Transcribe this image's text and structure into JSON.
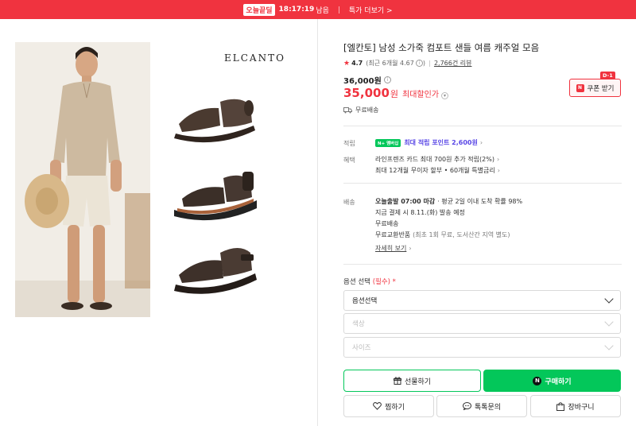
{
  "banner": {
    "logo": "오늘끝딜",
    "time": "18:17:19",
    "time_suffix": "남음",
    "link": "특가 더보기 >"
  },
  "gallery": {
    "brand": "ELCANTO"
  },
  "product": {
    "title": "[엘칸토] 남성 소가죽 컴포트 샌들 여름 캐주얼 모음",
    "rating": "4.7",
    "rating_detail": "(최근 6개월 4.67",
    "rating_detail_end": ")",
    "reviews": "2,766건 리뷰",
    "original_price": "36,000원",
    "sale_price": "35,000",
    "sale_unit": "원",
    "max_discount": "최대할인가",
    "coupon_badge": "D-1",
    "coupon_label": "쿠폰 받기",
    "shipping_free": "무료배송"
  },
  "benefits": {
    "points_label": "적립",
    "npay_badge": "N+ 멤버십",
    "points_text": "최대 적립 포인트 2,600원",
    "benefit_label": "혜택",
    "card_text": "라인프렌즈 카드 최대 700원 추가 적립(2%)",
    "installment_text": "최대 12개월 무이자 할부 • 60개월 특별금리"
  },
  "delivery": {
    "label": "배송",
    "today_bold": "오늘출발 07:00 마감",
    "today_rest": "· 평균 2일 이내 도착 확률 98%",
    "pay_now": "지금 결제 시 8.11.(화) 발송 예정",
    "free": "무료배송",
    "exchange": "무료교환반품",
    "exchange_detail": "(최초 1회 무료, 도서산간 지역 별도)",
    "detail_link": "자세히 보기"
  },
  "options": {
    "label": "옵션 선택",
    "required": "(필수) *",
    "select1": "옵션선택",
    "select2": "색상",
    "select3": "사이즈"
  },
  "buttons": {
    "gift": "선물하기",
    "buy": "구매하기",
    "wish": "찜하기",
    "talk": "톡톡문의",
    "cart": "장바구니"
  },
  "colors": {
    "accent_red": "#f0333f",
    "naver_green": "#03c75a",
    "points_purple": "#5a48e6"
  }
}
